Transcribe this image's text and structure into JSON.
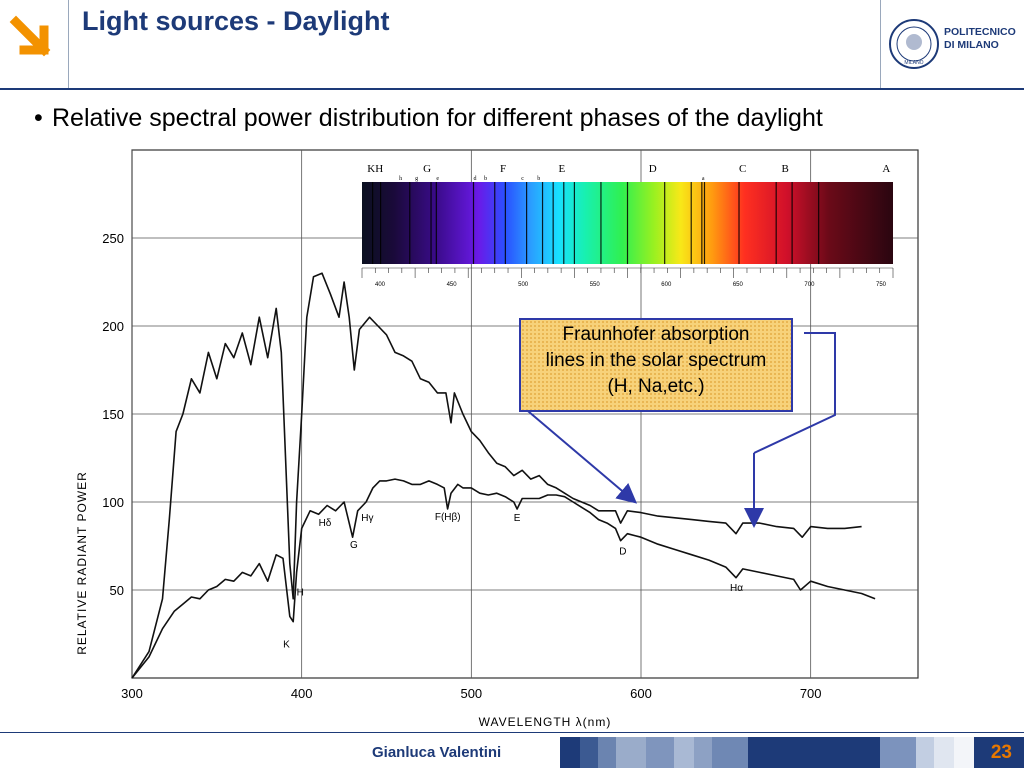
{
  "header": {
    "title": "Light sources - Daylight",
    "institution": "POLITECNICO DI MILANO",
    "institution_lines": [
      "POLITECNICO",
      "DI MILANO"
    ],
    "seal_text": "MILANO",
    "accent_color": "#f39200",
    "brand_color": "#1d3a78"
  },
  "bullet": {
    "text": "Relative spectral power distribution for different phases of the daylight"
  },
  "callout": {
    "lines": [
      "Fraunhofer absorption",
      "lines in the solar spectrum",
      "(H, Na,etc.)"
    ],
    "border_color": "#2e39a8",
    "fill_color": "#f7d27a"
  },
  "chart_data": {
    "type": "line",
    "xlabel": "WAVELENGTH  λ(nm)",
    "ylabel": "RELATIVE  RADIANT  POWER",
    "xlim": [
      300,
      750
    ],
    "ylim": [
      0,
      300
    ],
    "x_ticks": [
      300,
      400,
      500,
      600,
      700
    ],
    "y_ticks": [
      50,
      100,
      150,
      200,
      250
    ],
    "grid": true,
    "series": [
      {
        "points": [
          [
            300,
            0
          ],
          [
            310,
            15
          ],
          [
            318,
            45
          ],
          [
            322,
            90
          ],
          [
            326,
            140
          ],
          [
            330,
            150
          ],
          [
            335,
            170
          ],
          [
            340,
            162
          ],
          [
            345,
            185
          ],
          [
            350,
            170
          ],
          [
            355,
            190
          ],
          [
            360,
            182
          ],
          [
            365,
            196
          ],
          [
            370,
            178
          ],
          [
            375,
            205
          ],
          [
            380,
            182
          ],
          [
            385,
            210
          ],
          [
            388,
            185
          ],
          [
            393,
            65
          ],
          [
            395,
            45
          ],
          [
            397,
            100
          ],
          [
            400,
            150
          ],
          [
            403,
            205
          ],
          [
            407,
            228
          ],
          [
            412,
            230
          ],
          [
            417,
            218
          ],
          [
            422,
            205
          ],
          [
            425,
            225
          ],
          [
            428,
            205
          ],
          [
            431,
            175
          ],
          [
            434,
            198
          ],
          [
            440,
            205
          ],
          [
            445,
            200
          ],
          [
            450,
            195
          ],
          [
            455,
            185
          ],
          [
            460,
            183
          ],
          [
            465,
            180
          ],
          [
            470,
            170
          ],
          [
            475,
            168
          ],
          [
            480,
            162
          ],
          [
            485,
            162
          ],
          [
            488,
            145
          ],
          [
            490,
            162
          ],
          [
            495,
            150
          ],
          [
            500,
            140
          ],
          [
            505,
            135
          ],
          [
            510,
            128
          ],
          [
            515,
            122
          ],
          [
            520,
            120
          ],
          [
            525,
            115
          ],
          [
            530,
            118
          ],
          [
            535,
            113
          ],
          [
            540,
            115
          ],
          [
            545,
            110
          ],
          [
            550,
            108
          ],
          [
            555,
            105
          ],
          [
            560,
            102
          ],
          [
            565,
            100
          ],
          [
            570,
            98
          ],
          [
            575,
            95
          ],
          [
            580,
            95
          ],
          [
            585,
            95
          ],
          [
            588,
            88
          ],
          [
            592,
            95
          ],
          [
            600,
            94
          ],
          [
            610,
            92
          ],
          [
            620,
            91
          ],
          [
            630,
            90
          ],
          [
            640,
            89
          ],
          [
            650,
            88
          ],
          [
            656,
            82
          ],
          [
            660,
            88
          ],
          [
            670,
            88
          ],
          [
            680,
            86
          ],
          [
            690,
            85
          ],
          [
            695,
            80
          ],
          [
            700,
            86
          ],
          [
            710,
            85
          ],
          [
            720,
            85
          ],
          [
            730,
            86
          ]
        ]
      },
      {
        "points": [
          [
            300,
            0
          ],
          [
            310,
            12
          ],
          [
            318,
            28
          ],
          [
            325,
            38
          ],
          [
            330,
            42
          ],
          [
            335,
            46
          ],
          [
            340,
            45
          ],
          [
            345,
            50
          ],
          [
            350,
            52
          ],
          [
            355,
            56
          ],
          [
            360,
            55
          ],
          [
            365,
            60
          ],
          [
            370,
            58
          ],
          [
            375,
            65
          ],
          [
            380,
            55
          ],
          [
            385,
            70
          ],
          [
            389,
            68
          ],
          [
            393,
            35
          ],
          [
            395,
            32
          ],
          [
            397,
            60
          ],
          [
            400,
            85
          ],
          [
            405,
            95
          ],
          [
            410,
            93
          ],
          [
            415,
            98
          ],
          [
            420,
            95
          ],
          [
            425,
            100
          ],
          [
            428,
            88
          ],
          [
            430,
            80
          ],
          [
            433,
            95
          ],
          [
            438,
            100
          ],
          [
            442,
            108
          ],
          [
            446,
            112
          ],
          [
            450,
            112
          ],
          [
            455,
            113
          ],
          [
            460,
            112
          ],
          [
            465,
            110
          ],
          [
            470,
            110
          ],
          [
            475,
            112
          ],
          [
            480,
            110
          ],
          [
            484,
            108
          ],
          [
            486,
            96
          ],
          [
            488,
            105
          ],
          [
            492,
            110
          ],
          [
            495,
            108
          ],
          [
            500,
            108
          ],
          [
            505,
            105
          ],
          [
            510,
            104
          ],
          [
            515,
            105
          ],
          [
            520,
            103
          ],
          [
            525,
            100
          ],
          [
            527,
            96
          ],
          [
            530,
            102
          ],
          [
            535,
            102
          ],
          [
            540,
            102
          ],
          [
            545,
            104
          ],
          [
            550,
            104
          ],
          [
            555,
            103
          ],
          [
            560,
            100
          ],
          [
            565,
            97
          ],
          [
            570,
            94
          ],
          [
            575,
            90
          ],
          [
            580,
            88
          ],
          [
            585,
            85
          ],
          [
            588,
            78
          ],
          [
            592,
            82
          ],
          [
            600,
            80
          ],
          [
            610,
            76
          ],
          [
            620,
            73
          ],
          [
            630,
            70
          ],
          [
            640,
            67
          ],
          [
            650,
            63
          ],
          [
            656,
            57
          ],
          [
            660,
            62
          ],
          [
            670,
            60
          ],
          [
            680,
            58
          ],
          [
            690,
            56
          ],
          [
            694,
            50
          ],
          [
            700,
            55
          ],
          [
            710,
            52
          ],
          [
            720,
            50
          ],
          [
            730,
            48
          ],
          [
            738,
            45
          ]
        ]
      }
    ],
    "annotations": [
      {
        "label": "K",
        "x": 393.4
      },
      {
        "label": "H",
        "x": 396.8
      },
      {
        "label": "Hδ",
        "x": 410.2
      },
      {
        "label": "Hγ",
        "x": 434.0
      },
      {
        "label": "G",
        "x": 430.8
      },
      {
        "label": "F(Hβ)",
        "x": 486.1
      },
      {
        "label": "E",
        "x": 527.0
      },
      {
        "label": "D",
        "x": 589.3
      },
      {
        "label": "Hα",
        "x": 656.3
      }
    ],
    "inset_spectrum": {
      "line_labels": [
        "KH",
        "G",
        "F",
        "E",
        "D",
        "C",
        "B",
        "A"
      ],
      "small_labels": [
        "h",
        "g",
        "e",
        "d",
        "b",
        "c",
        "b",
        "a"
      ],
      "scale_labels": [
        "400",
        "450",
        "500",
        "550",
        "600",
        "650",
        "700",
        "750"
      ]
    }
  },
  "footer": {
    "author": "Gianluca Valentini",
    "page_number": "23"
  }
}
